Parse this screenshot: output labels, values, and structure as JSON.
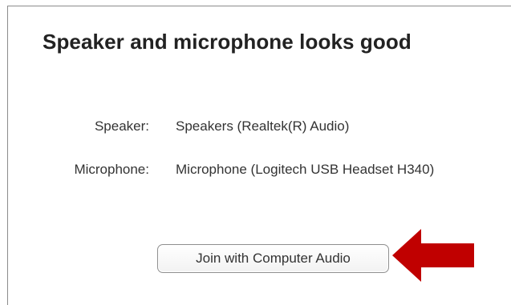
{
  "dialog": {
    "title": "Speaker and microphone looks good",
    "rows": [
      {
        "label": "Speaker:",
        "value": "Speakers (Realtek(R) Audio)"
      },
      {
        "label": "Microphone:",
        "value": "Microphone (Logitech USB Headset H340)"
      }
    ],
    "join_button_label": "Join with Computer Audio"
  },
  "annotation": {
    "icon": "arrow-left-icon",
    "color": "#c00000"
  }
}
